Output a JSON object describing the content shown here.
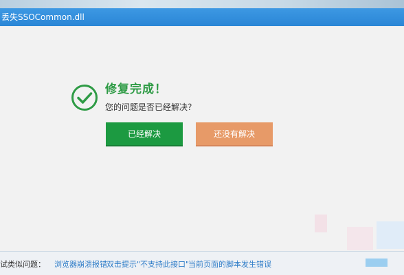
{
  "window": {
    "title": "丢失SSOCommon.dll"
  },
  "result": {
    "title": "修复完成！",
    "question": "您的问题是否已经解决？",
    "resolved_button": "已经解决",
    "unresolved_button": "还没有解决",
    "icon": "check-circle-icon"
  },
  "footer": {
    "label": "试类似问题：",
    "links": [
      "浏览器崩溃报错",
      "双击提示\"不支持此接口\"",
      "当前页面的脚本发生错误"
    ]
  },
  "colors": {
    "titlebar": "#2a86d6",
    "success_green": "#2e9b45",
    "resolved_button": "#1c9a41",
    "unresolved_button": "#e79a68",
    "link": "#2d7cc8"
  }
}
